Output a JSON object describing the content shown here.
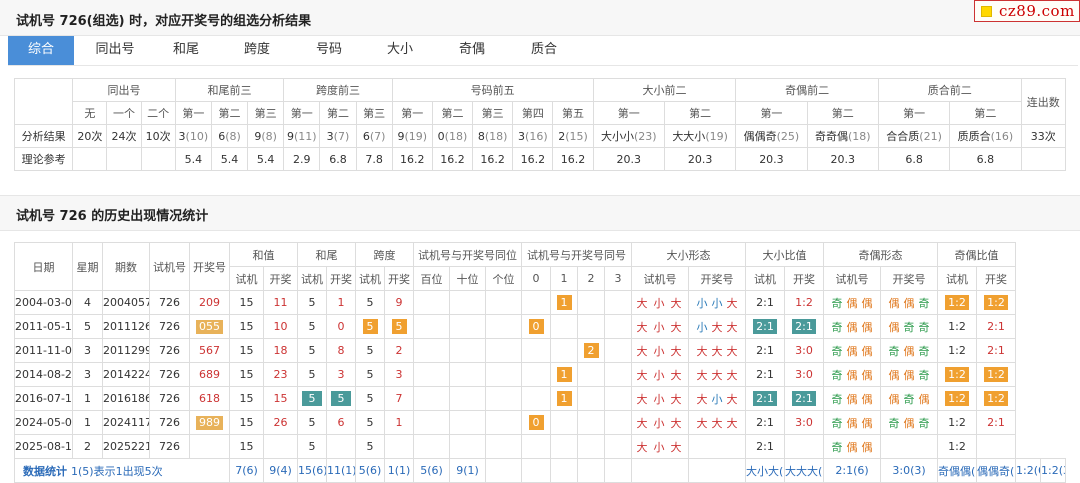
{
  "header": {
    "title": "试机号 726(组选) 时，对应开奖号的组选分析结果",
    "logo": "cz89.com"
  },
  "tabs": [
    "综合",
    "同出号",
    "和尾",
    "跨度",
    "号码",
    "大小",
    "奇偶",
    "质合"
  ],
  "summary": {
    "groups": [
      "同出号",
      "和尾前三",
      "跨度前三",
      "号码前五",
      "大小前二",
      "奇偶前二",
      "质合前二",
      "连出数"
    ],
    "subs": [
      "无",
      "一个",
      "二个",
      "第一",
      "第二",
      "第三",
      "第一",
      "第二",
      "第三",
      "第一",
      "第二",
      "第三",
      "第四",
      "第五",
      "第一",
      "第二",
      "第一",
      "第二",
      "第一",
      "第二"
    ],
    "row1_label": "分析结果",
    "row1": [
      [
        "20次",
        ""
      ],
      [
        "24次",
        ""
      ],
      [
        "10次",
        ""
      ],
      [
        "3",
        "(10)"
      ],
      [
        "6",
        "(8)"
      ],
      [
        "9",
        "(8)"
      ],
      [
        "9",
        "(11)"
      ],
      [
        "3",
        "(7)"
      ],
      [
        "6",
        "(7)"
      ],
      [
        "9",
        "(19)"
      ],
      [
        "0",
        "(18)"
      ],
      [
        "8",
        "(18)"
      ],
      [
        "3",
        "(16)"
      ],
      [
        "2",
        "(15)"
      ],
      [
        "大小小",
        "(23)"
      ],
      [
        "大大小",
        "(19)"
      ],
      [
        "偶偶奇",
        "(25)"
      ],
      [
        "奇奇偶",
        "(18)"
      ],
      [
        "合合质",
        "(21)"
      ],
      [
        "质质合",
        "(16)"
      ],
      [
        "33次",
        ""
      ]
    ],
    "row2_label": "理论参考",
    "row2": [
      "",
      "",
      "",
      "5.4",
      "5.4",
      "5.4",
      "2.9",
      "6.8",
      "7.8",
      "16.2",
      "16.2",
      "16.2",
      "16.2",
      "16.2",
      "20.3",
      "20.3",
      "20.3",
      "20.3",
      "6.8",
      "6.8",
      ""
    ]
  },
  "history": {
    "title": "试机号 726 的历史出现情况统计",
    "heads": {
      "date": "日期",
      "week": "星期",
      "period": "期数",
      "sjh": "试机号",
      "kjh": "开奖号",
      "hz": "和值",
      "hw": "和尾",
      "kd": "跨度",
      "pos": "试机号与开奖号同位",
      "same": "试机号与开奖号同号",
      "dxxt": "大小形态",
      "dxb": "大小比值",
      "joxt": "奇偶形态",
      "job": "奇偶比值"
    },
    "subs": {
      "sj": "试机",
      "kj": "开奖",
      "bai": "百位",
      "shi": "十位",
      "ge": "个位",
      "n0": "0",
      "n1": "1",
      "n2": "2",
      "n3": "3",
      "sjh": "试机号",
      "kjh": "开奖号"
    },
    "rows": [
      {
        "date": "2004-03-04",
        "week": "4",
        "period": "2004057",
        "sjh": "726",
        "kjh": "209",
        "hz_s": "15",
        "hz_k": "11",
        "hw_s": "5",
        "hw_k": "1",
        "kd_s": "5",
        "kd_k": "9",
        "same": "1",
        "dx_s": [
          "大",
          "小",
          "大"
        ],
        "dx_k": [
          "小",
          "小",
          "大"
        ],
        "dxb_s": "2:1",
        "dxb_k": "1:2",
        "jo_s": [
          "奇",
          "偶",
          "偶"
        ],
        "jo_k": [
          "偶",
          "偶",
          "奇"
        ],
        "job_s": "1:2",
        "job_k": "1:2"
      },
      {
        "date": "2011-05-13",
        "week": "5",
        "period": "2011126",
        "sjh": "726",
        "kjh": "055",
        "hz_s": "15",
        "hz_k": "10",
        "hw_s": "5",
        "hw_k": "0",
        "kd_s": "5",
        "kd_k": "5",
        "same": "0",
        "dx_s": [
          "大",
          "小",
          "大"
        ],
        "dx_k": [
          "小",
          "大",
          "大"
        ],
        "dxb_s": "2:1",
        "dxb_k": "2:1",
        "jo_s": [
          "奇",
          "偶",
          "偶"
        ],
        "jo_k": [
          "偶",
          "奇",
          "奇"
        ],
        "job_s": "1:2",
        "job_k": "2:1"
      },
      {
        "date": "2011-11-02",
        "week": "3",
        "period": "2011299",
        "sjh": "726",
        "kjh": "567",
        "hz_s": "15",
        "hz_k": "18",
        "hw_s": "5",
        "hw_k": "8",
        "kd_s": "5",
        "kd_k": "2",
        "same": "2",
        "dx_s": [
          "大",
          "小",
          "大"
        ],
        "dx_k": [
          "大",
          "大",
          "大"
        ],
        "dxb_s": "2:1",
        "dxb_k": "3:0",
        "jo_s": [
          "奇",
          "偶",
          "偶"
        ],
        "jo_k": [
          "奇",
          "偶",
          "奇"
        ],
        "job_s": "1:2",
        "job_k": "2:1"
      },
      {
        "date": "2014-08-20",
        "week": "3",
        "period": "2014224",
        "sjh": "726",
        "kjh": "689",
        "hz_s": "15",
        "hz_k": "23",
        "hw_s": "5",
        "hw_k": "3",
        "kd_s": "5",
        "kd_k": "3",
        "same": "1",
        "dx_s": [
          "大",
          "小",
          "大"
        ],
        "dx_k": [
          "大",
          "大",
          "大"
        ],
        "dxb_s": "2:1",
        "dxb_k": "3:0",
        "jo_s": [
          "奇",
          "偶",
          "偶"
        ],
        "jo_k": [
          "偶",
          "偶",
          "奇"
        ],
        "job_s": "1:2",
        "job_k": "1:2"
      },
      {
        "date": "2016-07-11",
        "week": "1",
        "period": "2016186",
        "sjh": "726",
        "kjh": "618",
        "hz_s": "15",
        "hz_k": "15",
        "hw_s": "5",
        "hw_k": "5",
        "kd_s": "5",
        "kd_k": "7",
        "same": "1",
        "dx_s": [
          "大",
          "小",
          "大"
        ],
        "dx_k": [
          "大",
          "小",
          "大"
        ],
        "dxb_s": "2:1",
        "dxb_k": "2:1",
        "jo_s": [
          "奇",
          "偶",
          "偶"
        ],
        "jo_k": [
          "偶",
          "奇",
          "偶"
        ],
        "job_s": "1:2",
        "job_k": "1:2"
      },
      {
        "date": "2024-05-06",
        "week": "1",
        "period": "2024117",
        "sjh": "726",
        "kjh": "989",
        "hz_s": "15",
        "hz_k": "26",
        "hw_s": "5",
        "hw_k": "6",
        "kd_s": "5",
        "kd_k": "1",
        "same": "0",
        "dx_s": [
          "大",
          "小",
          "大"
        ],
        "dx_k": [
          "大",
          "大",
          "大"
        ],
        "dxb_s": "2:1",
        "dxb_k": "3:0",
        "jo_s": [
          "奇",
          "偶",
          "偶"
        ],
        "jo_k": [
          "奇",
          "偶",
          "奇"
        ],
        "job_s": "1:2",
        "job_k": "2:1"
      },
      {
        "date": "2025-08-19",
        "week": "2",
        "period": "2025221",
        "sjh": "726",
        "kjh": "",
        "hz_s": "15",
        "hz_k": "",
        "hw_s": "5",
        "hw_k": "",
        "kd_s": "5",
        "kd_k": "",
        "same": "",
        "dx_s": [
          "大",
          "小",
          "大"
        ],
        "dx_k": [
          "",
          "",
          ""
        ],
        "dxb_s": "2:1",
        "dxb_k": "",
        "jo_s": [
          "奇",
          "偶",
          "偶"
        ],
        "jo_k": [
          "",
          "",
          ""
        ],
        "job_s": "1:2",
        "job_k": ""
      }
    ],
    "stat_label": "数据统计",
    "stat_note": "1(5)表示1出现5次",
    "stats": [
      "7(6)",
      "9(4)",
      "15(6)",
      "11(1)",
      "5(6)",
      "1(1)",
      "5(6)",
      "9(1)",
      "",
      "",
      "",
      "",
      "",
      "",
      "",
      "大小大(6)",
      "大大大(3)",
      "2:1(6)",
      "3:0(3)",
      "奇偶偶(6)",
      "偶偶奇(2)",
      "1:2(6)",
      "1:2(3)"
    ]
  }
}
